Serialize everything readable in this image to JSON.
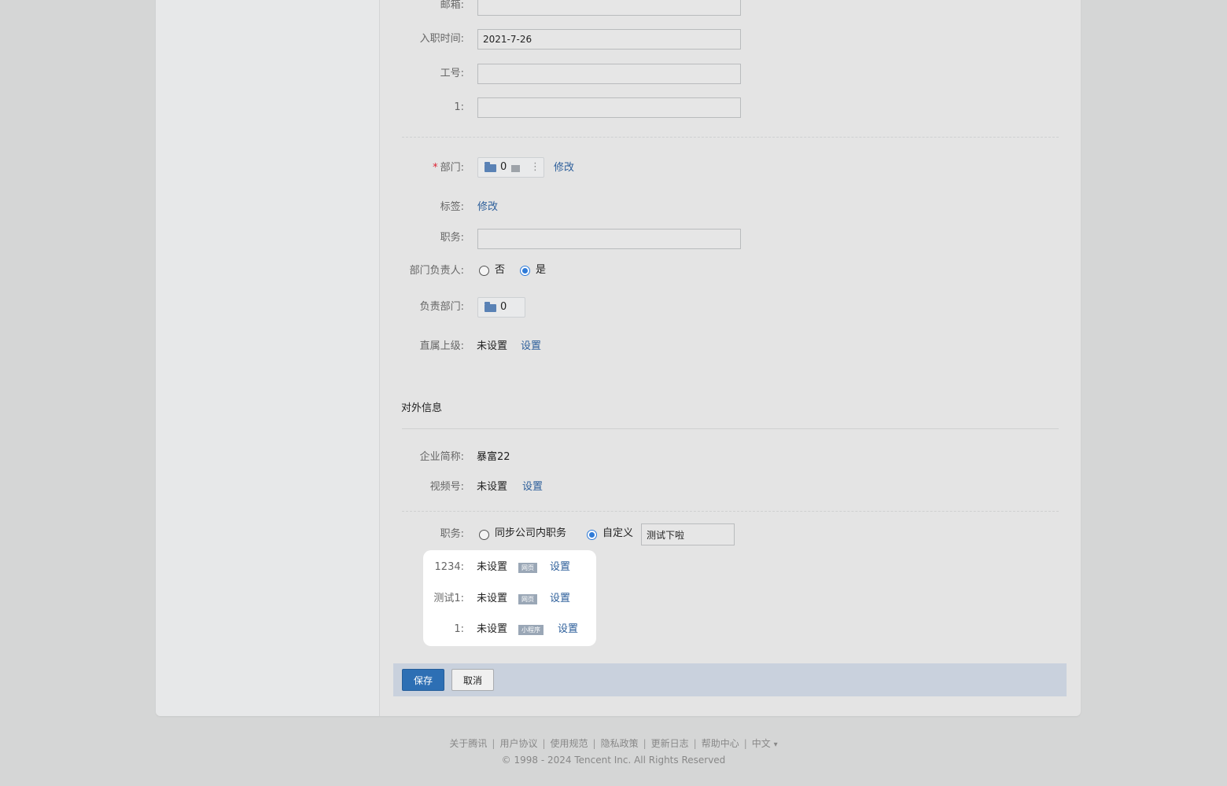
{
  "form": {
    "email_label": "邮箱:",
    "join_date_label": "入职时间:",
    "join_date_value": "2021-7-26",
    "employee_id_label": "工号:",
    "custom1_label": "1:",
    "dept_required_mark": "*",
    "dept_label": "部门:",
    "dept_count": "0",
    "dept_menu_glyph": "⋮",
    "dept_modify": "修改",
    "tags_label": "标签:",
    "tags_modify": "修改",
    "position_label": "职务:",
    "dept_head_label": "部门负责人:",
    "dept_head_no": "否",
    "dept_head_yes": "是",
    "dept_head_selected": "是",
    "managed_dept_label": "负责部门:",
    "managed_dept_count": "0",
    "supervisor_label": "直属上级:",
    "supervisor_value": "未设置",
    "supervisor_set": "设置"
  },
  "external": {
    "section_title": "对外信息",
    "company_short_label": "企业简称:",
    "company_short_value": "暴富22",
    "channels_label": "视频号:",
    "channels_value": "未设置",
    "channels_set": "设置",
    "ext_position_label": "职务:",
    "ext_position_sync": "同步公司内职务",
    "ext_position_custom": "自定义",
    "ext_position_selected": "自定义",
    "ext_position_custom_value": "测试下啦",
    "fields": [
      {
        "label": "1234:",
        "value": "未设置",
        "tag": "网页",
        "action": "设置"
      },
      {
        "label": "测试1:",
        "value": "未设置",
        "tag": "网页",
        "action": "设置"
      },
      {
        "label": "1:",
        "value": "未设置",
        "tag": "小程序",
        "action": "设置"
      }
    ]
  },
  "actions": {
    "save": "保存",
    "cancel": "取消"
  },
  "footer": {
    "links": [
      "关于腾讯",
      "用户协议",
      "使用规范",
      "隐私政策",
      "更新日志",
      "帮助中心",
      "中文"
    ],
    "separator": "|",
    "language_caret": "▾",
    "copyright": "© 1998 - 2024 Tencent Inc. All Rights Reserved"
  },
  "colors": {
    "link": "#2c5e9a",
    "primary_button": "#2d6fb4",
    "radio_active": "#2f7bd8",
    "required": "#dd2233"
  }
}
